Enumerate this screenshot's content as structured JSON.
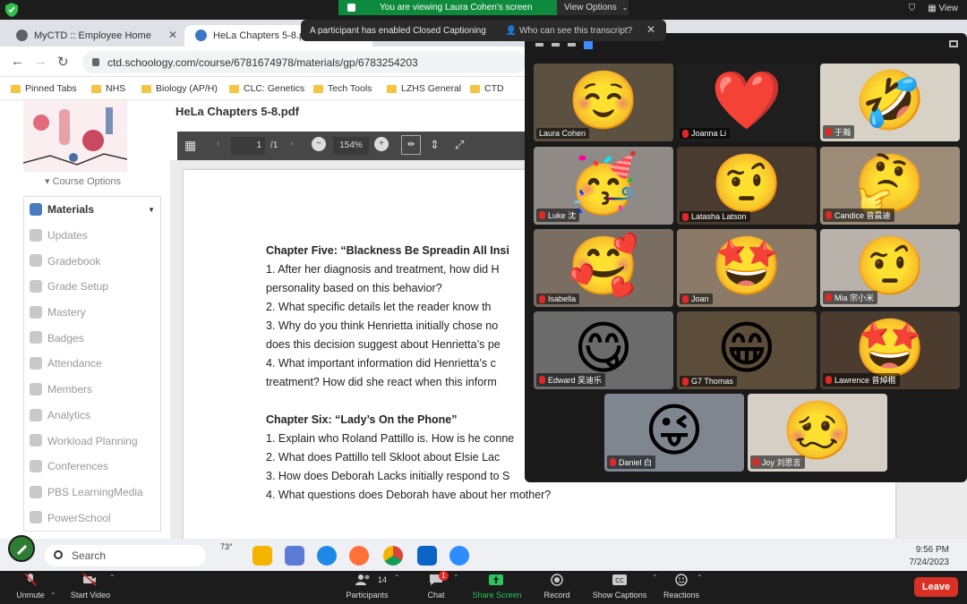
{
  "zoom_top": {
    "viewing_banner": "You are viewing Laura Cohen's screen",
    "view_options": "View Options",
    "view_label": "View"
  },
  "caption_notice": {
    "message": "A participant has enabled Closed Captioning",
    "who_link": "Who can see this transcript?"
  },
  "browser": {
    "tabs": [
      {
        "label": "MyCTD :: Employee Home"
      },
      {
        "label": "HeLa Chapters 5-8.pdf | Schoolo"
      }
    ],
    "url": "ctd.schoology.com/course/6781674978/materials/gp/6783254203",
    "bookmarks": [
      "Pinned Tabs",
      "NHS",
      "Biology (AP/H)",
      "CLC: Genetics",
      "Tech Tools",
      "LZHS General",
      "CTD"
    ]
  },
  "schoology": {
    "course_options": "Course Options",
    "menu": [
      {
        "label": "Materials",
        "active": true
      },
      {
        "label": "Updates"
      },
      {
        "label": "Gradebook"
      },
      {
        "label": "Grade Setup"
      },
      {
        "label": "Mastery"
      },
      {
        "label": "Badges"
      },
      {
        "label": "Attendance"
      },
      {
        "label": "Members"
      },
      {
        "label": "Analytics"
      },
      {
        "label": "Workload Planning"
      },
      {
        "label": "Conferences"
      },
      {
        "label": "PBS LearningMedia"
      },
      {
        "label": "PowerSchool"
      }
    ]
  },
  "pdf": {
    "title_partial": "HeLa Chapters 5-8.pdf",
    "page_current": "1",
    "page_total": "/1",
    "zoom": "154%",
    "lines": [
      {
        "text": "Chapter Five: “Blackness Be Spreadin All Insi",
        "bold": true
      },
      {
        "text": "1. After her diagnosis and treatment, how did H"
      },
      {
        "text": "personality based on this behavior?"
      },
      {
        "text": "2. What specific details let the reader know th"
      },
      {
        "text": "3. Why do you think Henrietta initially chose no"
      },
      {
        "text": "does this decision suggest about Henrietta’s pe"
      },
      {
        "text": "4. What important information did Henrietta’s c"
      },
      {
        "text": "treatment? How did she react when this inform"
      },
      {
        "text": ""
      },
      {
        "text": "Chapter Six: “Lady’s On the Phone”",
        "bold": true
      },
      {
        "text": "1. Explain who Roland Pattillo is. How is he conne"
      },
      {
        "text": "2. What does Pattillo tell Skloot about Elsie Lac"
      },
      {
        "text": "3. How does Deborah Lacks initially respond to S"
      },
      {
        "text": "4. What questions does Deborah have about her mother?"
      }
    ]
  },
  "gallery": {
    "participants": [
      {
        "name": "Laura Cohen",
        "emoji": "☺️",
        "muted": false,
        "active": true,
        "bg": "#5c5040"
      },
      {
        "name": "Joanna Li",
        "emoji": "❤️",
        "muted": true,
        "bg": "#1e1e1e"
      },
      {
        "name": "于瀚",
        "emoji": "🤣",
        "muted": true,
        "bg": "#d8d2c6"
      },
      {
        "name": "Luke 沈",
        "emoji": "🥳",
        "muted": true,
        "bg": "#8f8a86"
      },
      {
        "name": "Latasha Latson",
        "emoji": "🤨",
        "muted": true,
        "bg": "#4a3b30"
      },
      {
        "name": "Candice 曾晨迪",
        "emoji": "🤔",
        "muted": true,
        "bg": "#9d8c78"
      },
      {
        "name": "Isabella",
        "emoji": "🥰",
        "muted": true,
        "bg": "#7a6e62"
      },
      {
        "name": "Joan",
        "emoji": "🤩",
        "muted": true,
        "bg": "#8b7a68"
      },
      {
        "name": "Mia 宗小米",
        "emoji": "🤨",
        "muted": true,
        "bg": "#b8b2aa"
      },
      {
        "name": "Edward 吴迪乐",
        "emoji": "😋",
        "muted": true,
        "bg": "#6b6b6b"
      },
      {
        "name": "G7 Thomas",
        "emoji": "😁",
        "muted": true,
        "bg": "#5c4c3a"
      },
      {
        "name": "Lawrence 曾焯楷",
        "emoji": "🤩",
        "muted": true,
        "bg": "#4c3c30"
      },
      {
        "name": "Daniel 白",
        "emoji": "😜",
        "muted": true,
        "bg": "#7f8690"
      },
      {
        "name": "Joy 刘思言",
        "emoji": "🥴",
        "muted": true,
        "bg": "#d5cfc5"
      }
    ]
  },
  "taskbar": {
    "search": "Search",
    "temperature": "73°",
    "time": "9:56 PM",
    "date": "7/24/2023"
  },
  "zoom_controls": {
    "unmute": "Unmute",
    "start_video": "Start Video",
    "participants": "Participants",
    "participant_count": "14",
    "chat": "Chat",
    "chat_badge": "1",
    "share_screen": "Share Screen",
    "record": "Record",
    "show_captions": "Show Captions",
    "reactions": "Reactions",
    "leave": "Leave"
  }
}
